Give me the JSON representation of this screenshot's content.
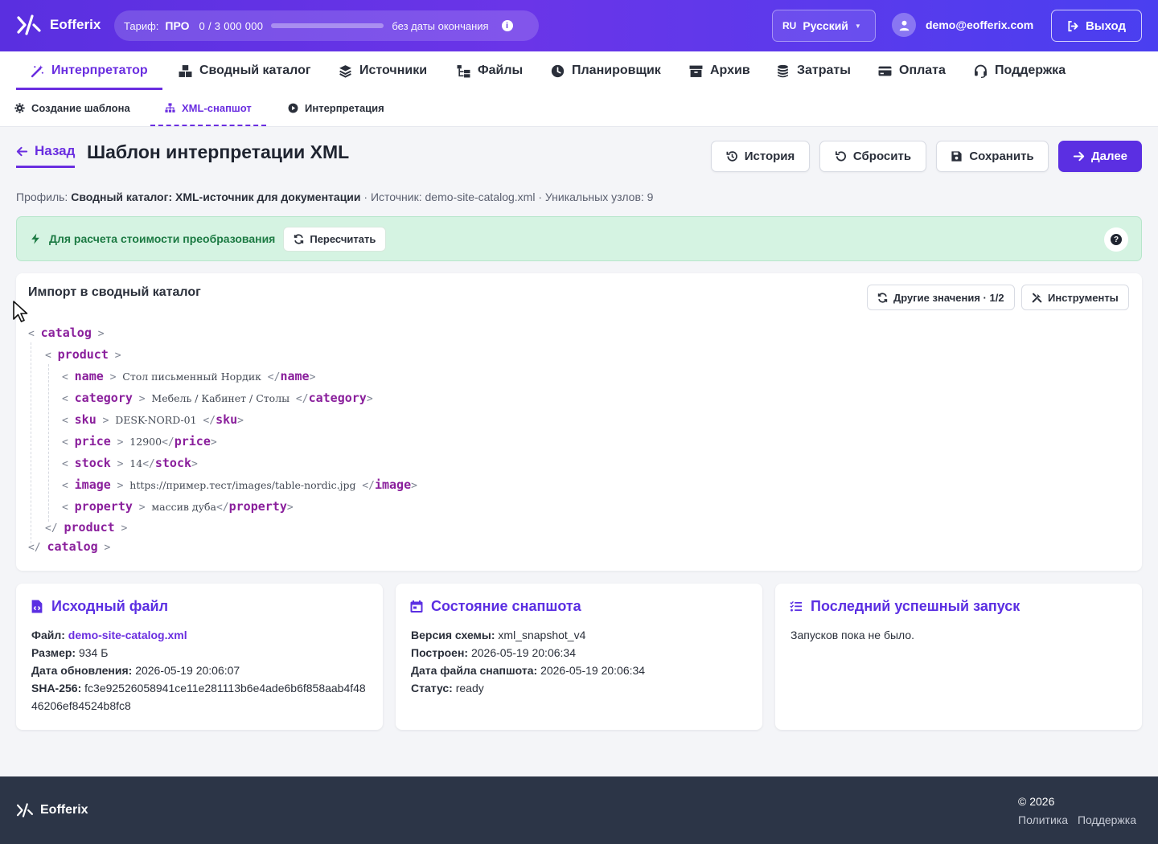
{
  "app": {
    "name": "Eofferix"
  },
  "plan": {
    "label": "Тариф:",
    "name": "ПРО",
    "used": "0",
    "separator": "/",
    "limit": "3 000 000",
    "usage_fraction": 0,
    "expiry": "без даты окончания"
  },
  "header": {
    "lang_code": "RU",
    "lang_name": "Русский",
    "user_email": "demo@eofferix.com",
    "logout_label": "Выход"
  },
  "nav": {
    "items": [
      {
        "label": "Интерпретатор",
        "icon": "magic-wand-icon",
        "active": true
      },
      {
        "label": "Сводный каталог",
        "icon": "boxes-icon"
      },
      {
        "label": "Источники",
        "icon": "layers-icon"
      },
      {
        "label": "Файлы",
        "icon": "folder-tree-icon"
      },
      {
        "label": "Планировщик",
        "icon": "clock-icon"
      },
      {
        "label": "Архив",
        "icon": "archive-icon"
      },
      {
        "label": "Затраты",
        "icon": "coins-icon"
      },
      {
        "label": "Оплата",
        "icon": "credit-card-icon"
      },
      {
        "label": "Поддержка",
        "icon": "headset-icon"
      }
    ]
  },
  "subnav": {
    "items": [
      {
        "label": "Создание шаблона",
        "icon": "gear-icon"
      },
      {
        "label": "XML-снапшот",
        "icon": "sitemap-icon",
        "active": true
      },
      {
        "label": "Интерпретация",
        "icon": "play-circle-icon"
      }
    ]
  },
  "page": {
    "back_label": "Назад",
    "title": "Шаблон интерпретации XML"
  },
  "actions": {
    "history": "История",
    "reset": "Сбросить",
    "save": "Сохранить",
    "next": "Далее"
  },
  "meta": {
    "profile_label": "Профиль:",
    "profile_value": "Сводный каталог: XML-источник для документации",
    "source_label": "· Источник:",
    "source_value": "demo-site-catalog.xml",
    "nodes_label": "· Уникальных узлов:",
    "nodes_value": "9"
  },
  "alert": {
    "text": "Для расчета стоимости преобразования",
    "recalc_label": "Пересчитать",
    "help": "?"
  },
  "xml_panel": {
    "title": "Импорт в сводный каталог",
    "other_values_label": "Другие значения · 1/2",
    "tools_label": "Инструменты",
    "root": "catalog",
    "item": "product",
    "fields": [
      {
        "tag": "name",
        "value": "Стол письменный Нордик"
      },
      {
        "tag": "category",
        "value": "Мебель / Кабинет / Столы"
      },
      {
        "tag": "sku",
        "value": "DESK-NORD-01"
      },
      {
        "tag": "price",
        "value": "12900"
      },
      {
        "tag": "stock",
        "value": "14"
      },
      {
        "tag": "image",
        "value": "https://пример.тест/images/table-nordic.jpg"
      },
      {
        "tag": "property",
        "value": "массив дуба"
      }
    ]
  },
  "cards": {
    "source_file": {
      "title": "Исходный файл",
      "file_label": "Файл:",
      "file_value": "demo-site-catalog.xml",
      "size_label": "Размер:",
      "size_value": "934 Б",
      "updated_label": "Дата обновления:",
      "updated_value": "2026-05-19 20:06:07",
      "sha_label": "SHA-256:",
      "sha_value": "fc3e92526058941ce11e281113b6e4ade6b6f858aab4f4846206ef84524b8fc8"
    },
    "snapshot": {
      "title": "Состояние снапшота",
      "schema_label": "Версия схемы:",
      "schema_value": "xml_snapshot_v4",
      "built_label": "Построен:",
      "built_value": "2026-05-19 20:06:34",
      "file_date_label": "Дата файла снапшота:",
      "file_date_value": "2026-05-19 20:06:34",
      "status_label": "Статус:",
      "status_value": "ready"
    },
    "last_run": {
      "title": "Последний успешный запуск",
      "text": "Запусков пока не было."
    }
  },
  "footer": {
    "brand": "Eofferix",
    "copyright": "© 2026",
    "policy": "Политика",
    "support": "Поддержка"
  },
  "colors": {
    "accent": "#5b2fe2",
    "tag": "#8a1f9c",
    "alert_bg": "#d5f3e2",
    "alert_text": "#1c7a43",
    "footer_bg": "#2c3547"
  }
}
